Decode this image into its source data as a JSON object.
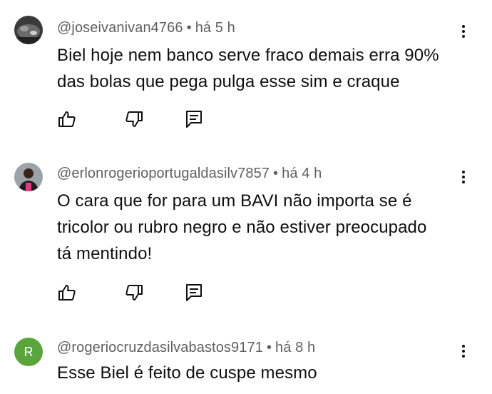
{
  "comments": [
    {
      "author": "@joseivanivan4766",
      "separator": "•",
      "time": "há 5 h",
      "text_lines": [
        "Biel hoje nem banco serve fraco demais erra 90%",
        "das bolas que pega pulga esse sim e craque"
      ],
      "avatar": {
        "type": "image",
        "icon": "photo-avatar"
      }
    },
    {
      "author": "@erlonrogerioportugaldasilv7857",
      "separator": "•",
      "time": "há 4 h",
      "text_lines": [
        "O cara que for para um BAVI não importa se é",
        "tricolor ou rubro negro e não estiver preocupado",
        "tá mentindo!"
      ],
      "avatar": {
        "type": "image",
        "icon": "person-avatar"
      }
    },
    {
      "author": "@rogeriocruzdasilvabastos9171",
      "separator": "•",
      "time": "há 8 h",
      "text_lines": [
        "Esse Biel é feito de cuspe mesmo"
      ],
      "avatar": {
        "type": "letter",
        "letter": "R",
        "color": "#5aa53b"
      }
    }
  ],
  "icons": {
    "like": "thumbs-up-icon",
    "dislike": "thumbs-down-icon",
    "reply": "reply-comment-icon",
    "menu": "more-vert-icon"
  },
  "colors": {
    "meta_text": "#606060",
    "body_text": "#0f0f0f",
    "icon": "#0f0f0f"
  }
}
